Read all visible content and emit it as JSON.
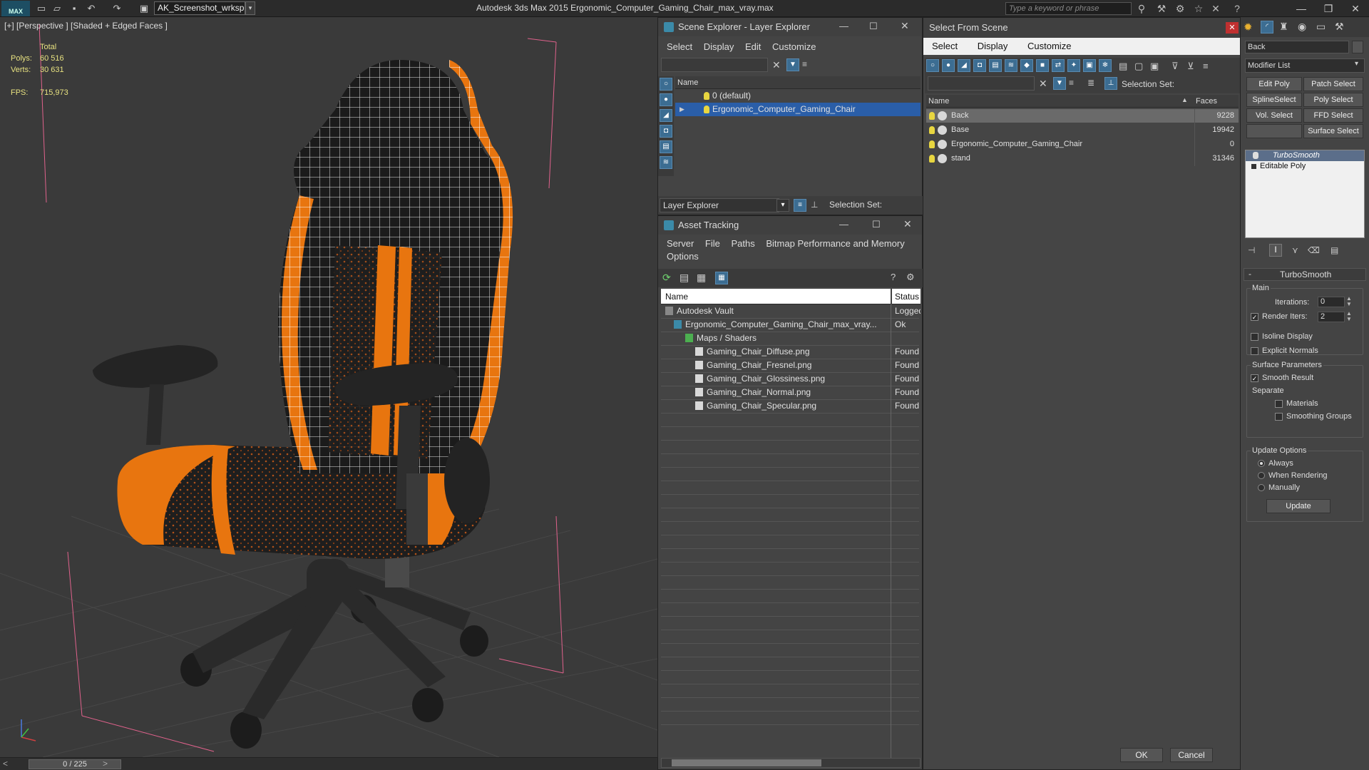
{
  "titlebar": {
    "logo": "MAX",
    "workspace": "AK_Screenshot_wrksp",
    "app_title": "Autodesk 3ds Max  2015     Ergonomic_Computer_Gaming_Chair_max_vray.max",
    "search_placeholder": "Type a keyword or phrase"
  },
  "viewport": {
    "label": "[+] [Perspective ] [Shaded + Edged Faces ]",
    "stats": {
      "total_label": "Total",
      "polys_label": "Polys:",
      "polys": "60 516",
      "verts_label": "Verts:",
      "verts": "30 631",
      "fps_label": "FPS:",
      "fps": "715,973"
    },
    "timeline": "0 / 225"
  },
  "scene_explorer": {
    "title": "Scene Explorer - Layer Explorer",
    "menu": [
      "Select",
      "Display",
      "Edit",
      "Customize"
    ],
    "col_name": "Name",
    "rows": [
      "0 (default)",
      "Ergonomic_Computer_Gaming_Chair"
    ],
    "footer_dropdown": "Layer Explorer",
    "selection_set": "Selection Set:"
  },
  "asset_tracking": {
    "title": "Asset Tracking",
    "menu": [
      "Server",
      "File",
      "Paths",
      "Bitmap Performance and Memory"
    ],
    "menu2": "Options",
    "col_name": "Name",
    "col_status": "Status",
    "rows": [
      {
        "name": "Autodesk Vault",
        "status": "Logged"
      },
      {
        "name": "Ergonomic_Computer_Gaming_Chair_max_vray...",
        "status": "Ok"
      },
      {
        "name": "Maps / Shaders",
        "status": ""
      },
      {
        "name": "Gaming_Chair_Diffuse.png",
        "status": "Found"
      },
      {
        "name": "Gaming_Chair_Fresnel.png",
        "status": "Found"
      },
      {
        "name": "Gaming_Chair_Glossiness.png",
        "status": "Found"
      },
      {
        "name": "Gaming_Chair_Normal.png",
        "status": "Found"
      },
      {
        "name": "Gaming_Chair_Specular.png",
        "status": "Found"
      }
    ]
  },
  "select_from_scene": {
    "title": "Select From Scene",
    "menu": [
      "Select",
      "Display",
      "Customize"
    ],
    "selection_set": "Selection Set:",
    "col_name": "Name",
    "col_faces": "Faces",
    "rows": [
      {
        "name": "Back",
        "faces": "9228"
      },
      {
        "name": "Base",
        "faces": "19942"
      },
      {
        "name": "Ergonomic_Computer_Gaming_Chair",
        "faces": "0"
      },
      {
        "name": "stand",
        "faces": "31346"
      }
    ],
    "ok": "OK",
    "cancel": "Cancel"
  },
  "command_panel": {
    "object_name": "Back",
    "modifier_list": "Modifier List",
    "buttons": [
      "Edit Poly",
      "Patch Select",
      "SplineSelect",
      "Poly Select",
      "Vol. Select",
      "FFD Select",
      "",
      "Surface Select"
    ],
    "stack": [
      "TurboSmooth",
      "Editable Poly"
    ],
    "rollout_title": "TurboSmooth",
    "main": "Main",
    "iterations_label": "Iterations:",
    "iterations": "0",
    "render_iters_label": "Render Iters:",
    "render_iters": "2",
    "isoline": "Isoline Display",
    "explicit": "Explicit Normals",
    "surface_params": "Surface Parameters",
    "smooth_result": "Smooth Result",
    "separate": "Separate",
    "materials": "Materials",
    "smoothing_groups": "Smoothing Groups",
    "update_options": "Update Options",
    "always": "Always",
    "when_rendering": "When Rendering",
    "manually": "Manually",
    "update": "Update"
  },
  "colors": {
    "accent": "#e8750f",
    "selection": "#2a5ea8",
    "bg": "#444444"
  }
}
